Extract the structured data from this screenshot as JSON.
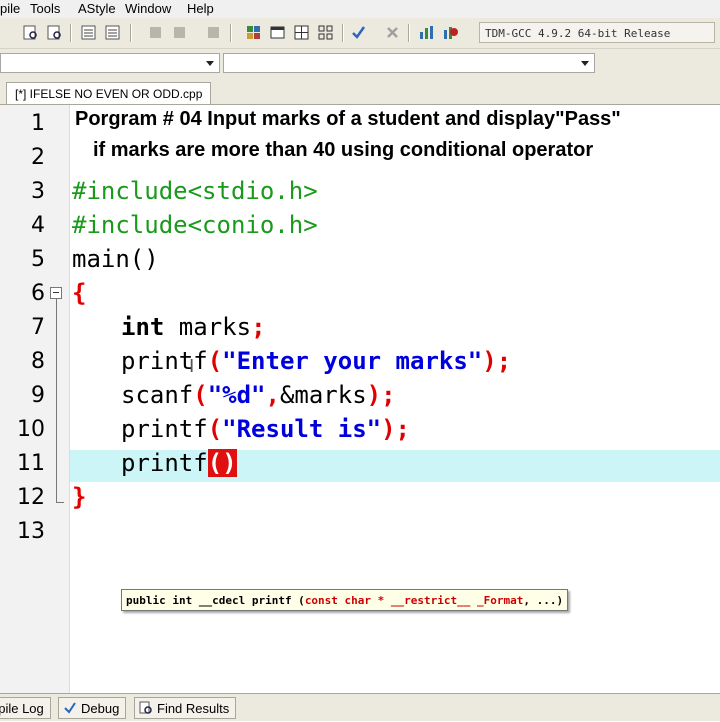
{
  "menu": [
    "pile",
    "Tools",
    "AStyle",
    "Window",
    "Help"
  ],
  "compiler": "TDM-GCC 4.9.2 64-bit Release",
  "tab_title": "[*] IFELSE NO EVEN OR ODD.cpp",
  "heading": {
    "line1": "Porgram # 04 Input marks of a student and display\"Pass\"",
    "line2": "if marks are more than 40 using conditional operator"
  },
  "line_numbers": [
    "1",
    "2",
    "3",
    "4",
    "5",
    "6",
    "7",
    "8",
    "9",
    "10",
    "11",
    "12",
    "13"
  ],
  "code": {
    "include1": "#include<stdio.h>",
    "include2": "#include<conio.h>",
    "main": "main()",
    "open_brace": "{",
    "int_kw": "int",
    "marks_decl": " marks",
    "semicolon": ";",
    "printf1_fn": "printf",
    "printf1_str": "\"Enter your marks\"",
    "scanf_fn": "scanf",
    "scanf_str": "\"%d\"",
    "scanf_rest": "&marks",
    "printf2_fn": "printf",
    "printf2_str": "\"Result is\"",
    "printf3_fn": "printf",
    "printf3_parens": "()",
    "close_brace": "}"
  },
  "tooltip": {
    "prefix": "public int __cdecl printf (",
    "param1": "const char * __restrict__ _Format",
    "rest": ", ...)"
  },
  "bottom_tabs": [
    "npile Log",
    "Debug",
    "Find Results"
  ]
}
